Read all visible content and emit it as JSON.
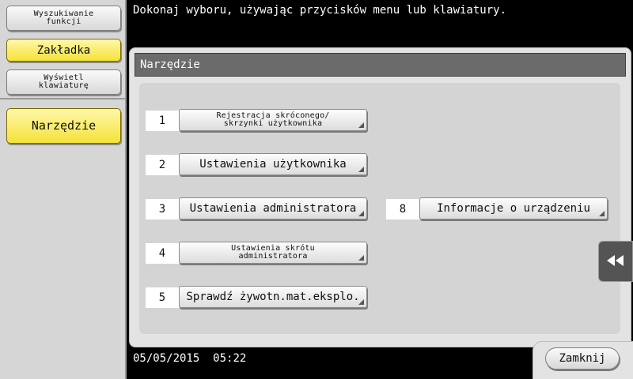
{
  "sidebar": {
    "search_label": "Wyszukiwanie funkcji",
    "bookmark_label": "Zakładka",
    "keyboard_label": "Wyświetl klawiaturę",
    "tool_label": "Narzędzie"
  },
  "message": "Dokonaj wyboru, używając przycisków menu lub klawiatury.",
  "panel": {
    "title": "Narzędzie",
    "items": [
      {
        "num": "1",
        "label": "Rejestracja skróconego/ skrzynki użytkownika"
      },
      {
        "num": "2",
        "label": "Ustawienia użytkownika"
      },
      {
        "num": "3",
        "label": "Ustawienia administratora"
      },
      {
        "num": "4",
        "label": "Ustawienia skrótu administratora"
      },
      {
        "num": "5",
        "label": "Sprawdź żywotn.mat.eksplo."
      },
      {
        "num": "8",
        "label": "Informacje o urządzeniu"
      }
    ]
  },
  "status": {
    "date": "05/05/2015",
    "time": "05:22"
  },
  "close_label": "Zamknij",
  "collapse_icon": "double-left-arrow"
}
